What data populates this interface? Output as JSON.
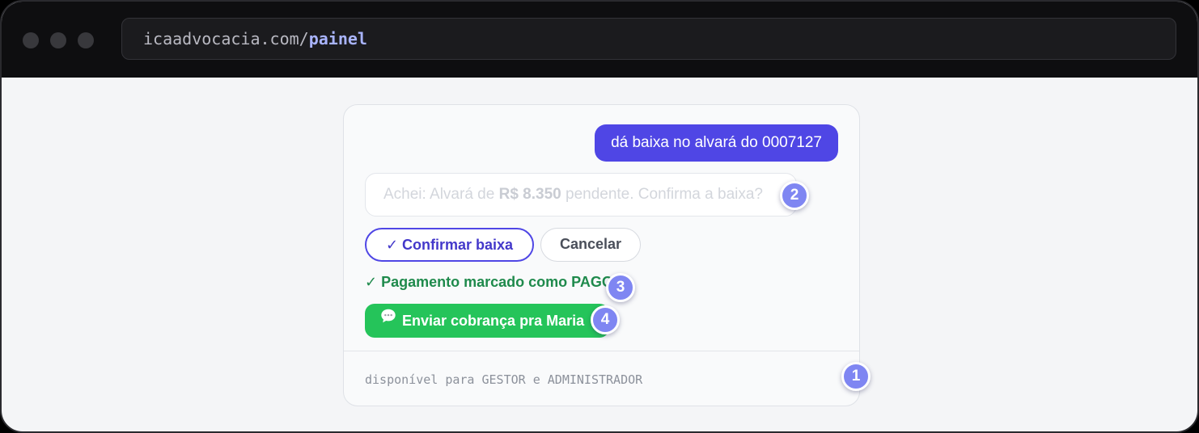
{
  "browser": {
    "url_host": "icaadvocacia.com/",
    "url_path": "painel"
  },
  "chat": {
    "user_message": "dá baixa no alvará do 0007127",
    "bot_message_prefix": "Achei: Alvará de ",
    "bot_message_amount": "R$ 8.350",
    "bot_message_suffix": " pendente. Confirma a baixa?",
    "confirm_label": "✓ Confirmar baixa",
    "cancel_label": "Cancelar",
    "status_text": "✓ Pagamento marcado como PAGO",
    "whatsapp_label": "Enviar cobrança pra Maria"
  },
  "footer": {
    "availability": "disponível para GESTOR e ADMINISTRADOR"
  },
  "badges": [
    "1",
    "2",
    "3",
    "4"
  ],
  "colors": {
    "accent": "#4f46e5",
    "success": "#1f8a4c",
    "whatsapp": "#25c45a",
    "badge": "#7f86f2"
  },
  "icons": {
    "window_controls": "traffic-light-dots",
    "chat": "speech-bubble-icon"
  }
}
